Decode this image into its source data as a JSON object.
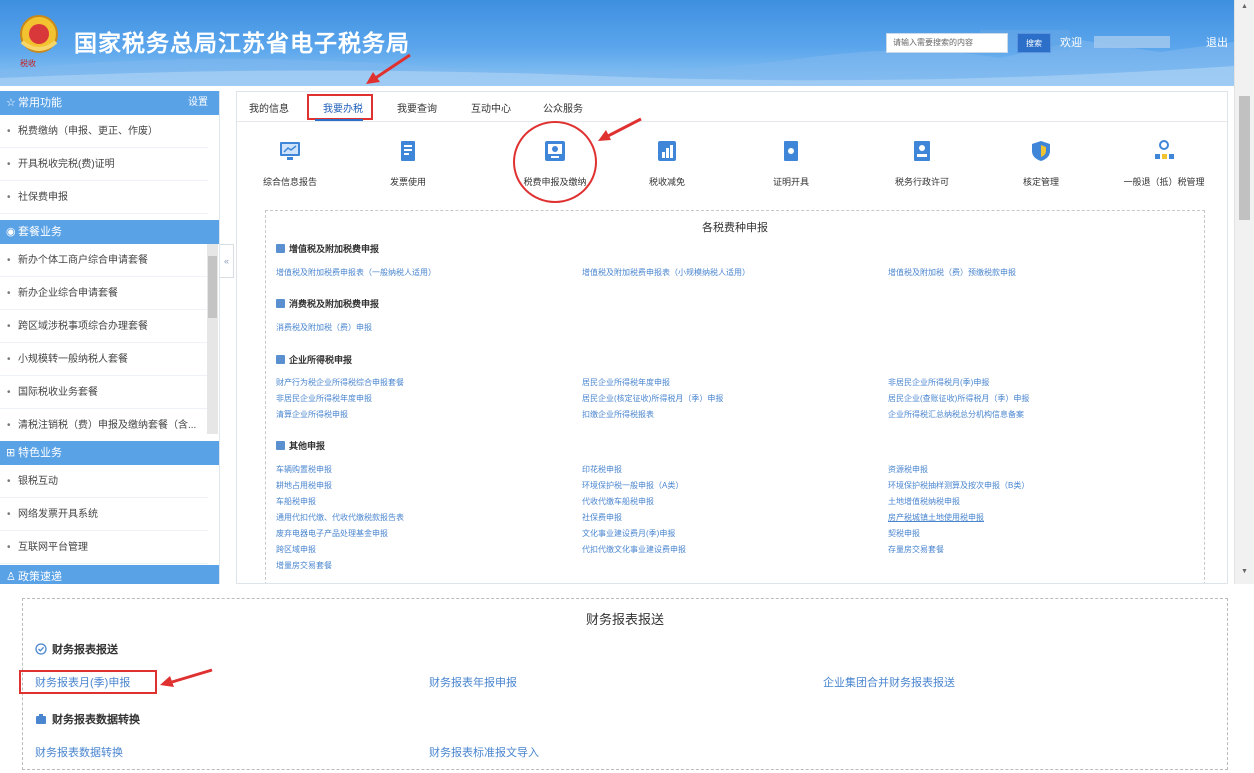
{
  "header": {
    "title": "国家税务总局江苏省电子税务局",
    "search_placeholder": "请输入需要搜索的内容",
    "search_button": "搜索",
    "welcome": "欢迎",
    "logout": "退出"
  },
  "sidebar": {
    "common": {
      "title": "常用功能",
      "settings": "设置"
    },
    "common_items": [
      "税费缴纳（申报、更正、作废）",
      "开具税收完税(费)证明",
      "社保费申报"
    ],
    "package": {
      "title": "套餐业务"
    },
    "package_items": [
      "新办个体工商户综合申请套餐",
      "新办企业综合申请套餐",
      "跨区域涉税事项综合办理套餐",
      "小规模转一般纳税人套餐",
      "国际税收业务套餐",
      "清税注销税（费）申报及缴纳套餐（含..."
    ],
    "feature": {
      "title": "特色业务"
    },
    "feature_items": [
      "银税互动",
      "网络发票开具系统",
      "互联网平台管理"
    ],
    "policy": {
      "title": "政策速递"
    }
  },
  "tabs": [
    "我的信息",
    "我要办税",
    "我要查询",
    "互动中心",
    "公众服务"
  ],
  "services": [
    "综合信息报告",
    "发票使用",
    "税费申报及缴纳",
    "税收减免",
    "证明开具",
    "税务行政许可",
    "核定管理",
    "一般退（抵）税管理"
  ],
  "tax_panel": {
    "title": "各税费种申报",
    "sections": [
      {
        "name": "增值税及附加税费申报",
        "links": [
          "增值税及附加税费申报表（一般纳税人适用）",
          "增值税及附加税费申报表（小规模纳税人适用）",
          "增值税及附加税（费）预缴税款申报"
        ]
      },
      {
        "name": "消费税及附加税费申报",
        "links": [
          "消费税及附加税（费）申报"
        ]
      },
      {
        "name": "企业所得税申报",
        "links": [
          "财产行为税企业所得税综合申报套餐",
          "居民企业所得税年度申报",
          "非居民企业所得税月(季)申报",
          "非居民企业所得税年度申报",
          "居民企业(核定征收)所得税月（季）申报",
          "居民企业(查账征收)所得税月（季）申报",
          "清算企业所得税申报",
          "扣缴企业所得税报表",
          "企业所得税汇总纳税总分机构信息备案"
        ]
      },
      {
        "name": "其他申报",
        "links": [
          "车辆购置税申报",
          "印花税申报",
          "资源税申报",
          "耕地占用税申报",
          "环境保护税一般申报（A类）",
          "环境保护税抽样测算及按次申报（B类）",
          "车船税申报",
          "代收代缴车船税申报",
          "土地增值税纳税申报",
          "通用代扣代缴、代收代缴税款报告表",
          "社保费申报",
          "房产税城镇土地使用税申报",
          "废弃电器电子产品处理基金申报",
          "文化事业建设费月(季)申报",
          "契税申报",
          "跨区域申报",
          "代扣代缴文化事业建设费申报",
          "存量房交易套餐",
          "增量房交易套餐"
        ]
      }
    ]
  },
  "finance_panel": {
    "title": "财务报表报送",
    "sections": [
      {
        "name": "财务报表报送",
        "links": [
          "财务报表月(季)申报",
          "财务报表年报申报",
          "企业集团合并财务报表报送"
        ]
      },
      {
        "name": "财务报表数据转换",
        "links": [
          "财务报表数据转换",
          "财务报表标准报文导入"
        ]
      }
    ]
  },
  "colors": {
    "header_blue": "#4a96e4",
    "accent_red": "#e03131",
    "link_blue": "#4a86cf",
    "sidebar_head": "#5aa2e6"
  },
  "icons": [
    "national-tax-emblem-icon",
    "star-icon",
    "package-icon",
    "feature-grid-icon",
    "person-icon",
    "report-monitor-icon",
    "invoice-icon",
    "declare-monitor-icon",
    "reduce-chart-icon",
    "certificate-icon",
    "license-icon",
    "shield-icon",
    "refund-tree-icon"
  ]
}
